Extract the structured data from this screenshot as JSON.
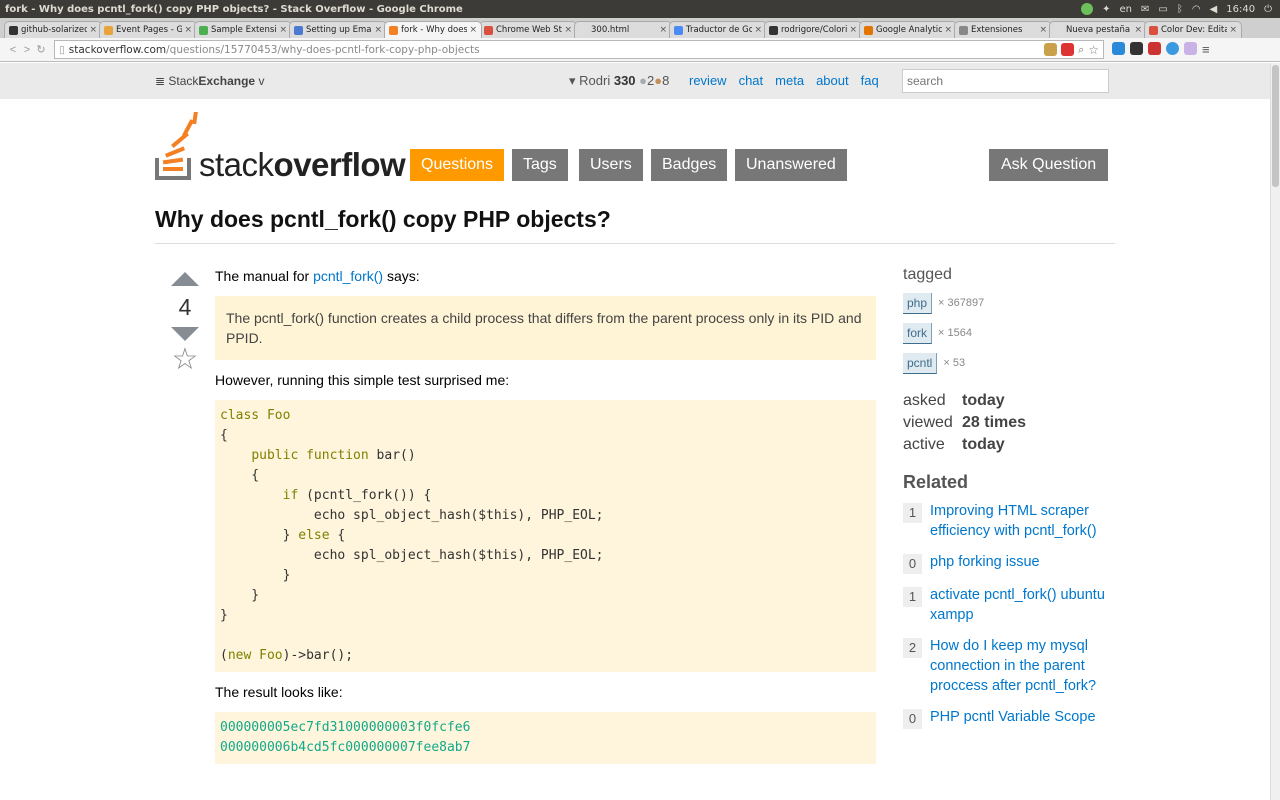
{
  "os": {
    "window_title": "fork - Why does pcntl_fork() copy PHP objects? - Stack Overflow - Google Chrome",
    "lang": "en",
    "time": "16:40"
  },
  "tabs": [
    {
      "label": "github-solarized",
      "color": "#333"
    },
    {
      "label": "Event Pages - Go",
      "color": "#e8a33d"
    },
    {
      "label": "Sample Extension",
      "color": "#4caf50"
    },
    {
      "label": "Setting up Email",
      "color": "#4a7bd0"
    },
    {
      "label": "fork - Why does",
      "color": "#f48024"
    },
    {
      "label": "Chrome Web Sto",
      "color": "#d9503f"
    },
    {
      "label": "300.html",
      "color": "#ddd"
    },
    {
      "label": "Traductor de Go",
      "color": "#4a8af4"
    },
    {
      "label": "rodrigore/Colori",
      "color": "#333"
    },
    {
      "label": "Google Analytics",
      "color": "#e37400"
    },
    {
      "label": "Extensiones",
      "color": "#888"
    },
    {
      "label": "Nueva pestaña",
      "color": "#ddd"
    },
    {
      "label": "Color Dev: Edita",
      "color": "#d9503f"
    }
  ],
  "address": {
    "host": "stackoverflow.com",
    "path": "/questions/15770453/why-does-pcntl-fork-copy-php-objects"
  },
  "se": {
    "brand_a": "Stack",
    "brand_b": "Exchange",
    "user_name": "Rodri",
    "rep": "330",
    "silver": "2",
    "bronze": "8",
    "links": [
      "review",
      "chat",
      "meta",
      "about",
      "faq"
    ],
    "search_placeholder": "search"
  },
  "logo": {
    "word_a": "stack",
    "word_b": "overflow"
  },
  "nav": {
    "questions": "Questions",
    "tags": "Tags",
    "users": "Users",
    "badges": "Badges",
    "unanswered": "Unanswered",
    "ask": "Ask Question"
  },
  "question": {
    "title": "Why does pcntl_fork() copy PHP objects?",
    "votes": "4",
    "intro_pre": "The manual for ",
    "intro_link": "pcntl_fork()",
    "intro_post": " says:",
    "quote": "The pcntl_fork() function creates a child process that differs from the parent process only in its PID and PPID.",
    "however": "However, running this simple test surprised me:",
    "result_intro": "The result looks like:",
    "result_line1": "000000005ec7fd31000000003f0fcfe6",
    "result_line2": "000000006b4cd5fc000000007fee8ab7"
  },
  "sidebar": {
    "tagged": "tagged",
    "tags": [
      {
        "name": "php",
        "count": "× 367897"
      },
      {
        "name": "fork",
        "count": "× 1564"
      },
      {
        "name": "pcntl",
        "count": "× 53"
      }
    ],
    "stats": [
      {
        "k": "asked",
        "v": "today"
      },
      {
        "k": "viewed",
        "v": "28 times"
      },
      {
        "k": "active",
        "v": "today"
      }
    ],
    "related_title": "Related",
    "related": [
      {
        "score": "1",
        "title": "Improving HTML scraper efficiency with pcntl_fork()"
      },
      {
        "score": "0",
        "title": "php forking issue"
      },
      {
        "score": "1",
        "title": "activate pcntl_fork() ubuntu xampp"
      },
      {
        "score": "2",
        "title": "How do I keep my mysql connection in the parent proccess after pcntl_fork?"
      },
      {
        "score": "0",
        "title": "PHP pcntl Variable Scope"
      }
    ]
  }
}
